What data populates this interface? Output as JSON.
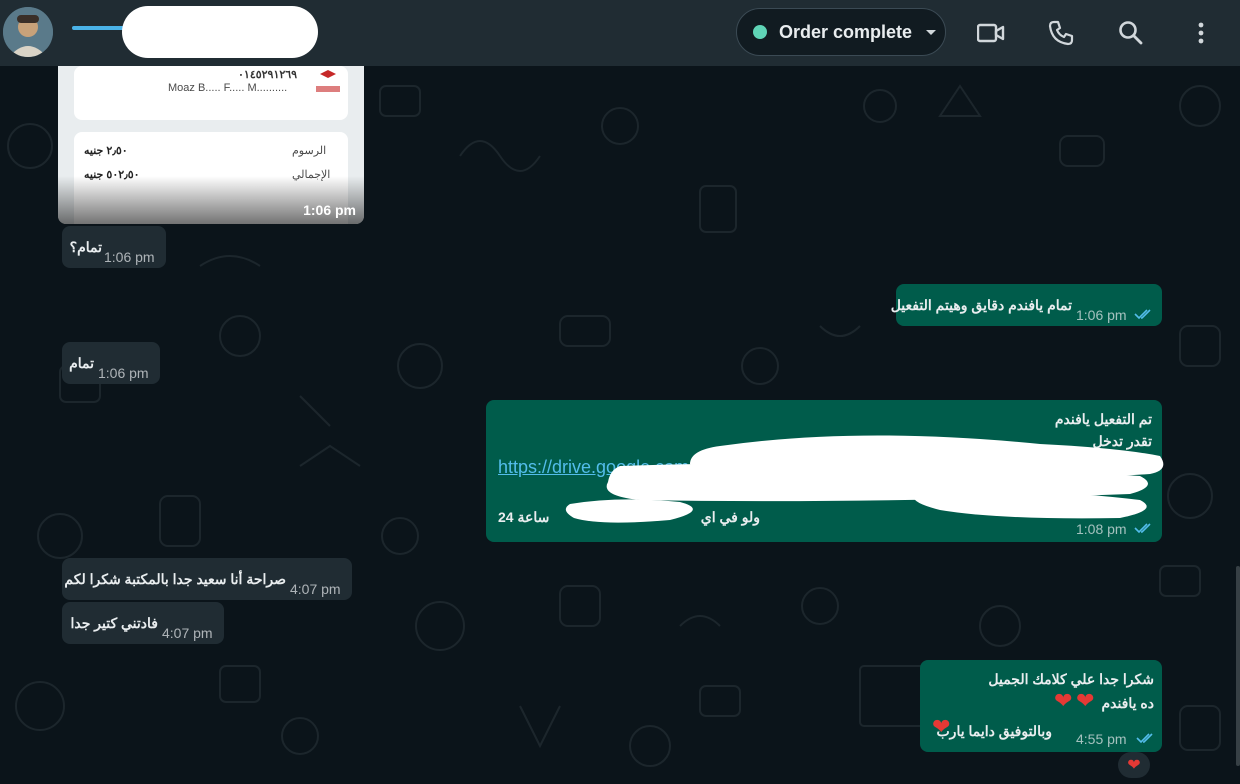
{
  "header": {
    "contact_name": "",
    "order_status": "Order complete",
    "icons": [
      "video-call-icon",
      "voice-call-icon",
      "search-icon",
      "menu-icon"
    ]
  },
  "colors": {
    "header_bg": "#202c33",
    "chat_bg": "#0b141a",
    "incoming_bubble": "#202c33",
    "outgoing_bubble": "#005c4b",
    "status_dot": "#5fd4b6",
    "read_ticks": "#53bdeb",
    "link": "#53bdeb"
  },
  "receipt": {
    "code": "٠١٤٥٢٩١٢٦٩",
    "name": "Moaz B..... F..... M..........",
    "fees_label": "الرسوم",
    "fees_value": "٢٫٥٠ جنيه",
    "total_label": "الإجمالي",
    "total_value": "٥٠٢٫٥٠ جنيه",
    "time": "1:06 pm"
  },
  "messages": [
    {
      "dir": "in",
      "text": "تمام؟",
      "time": "1:06 pm"
    },
    {
      "dir": "out",
      "text": "تمام يافندم دقايق وهيتم التفعيل",
      "time": "1:06 pm"
    },
    {
      "dir": "in",
      "text": "تمام",
      "time": "1:06 pm"
    },
    {
      "dir": "out",
      "line1": "تم التفعيل يافندم",
      "line2": "تقدر تدخل",
      "link": "https://drive.google.com/drive/folder",
      "line4": "ولو في اي",
      "line4b": "24 ساعة",
      "time": "1:08 pm"
    },
    {
      "dir": "in",
      "text": "صراحة أنا سعيد جدا بالمكتبة شكرا لكم",
      "time": "4:07 pm"
    },
    {
      "dir": "in",
      "text": "فادتني كتير جدا",
      "time": "4:07 pm"
    },
    {
      "dir": "out",
      "line1": "شكرا جدا علي كلامك الجميل",
      "line2": "ده يافندم",
      "line3": "وبالتوفيق دايما يارب",
      "time": "4:55 pm",
      "reaction": "❤️"
    }
  ]
}
